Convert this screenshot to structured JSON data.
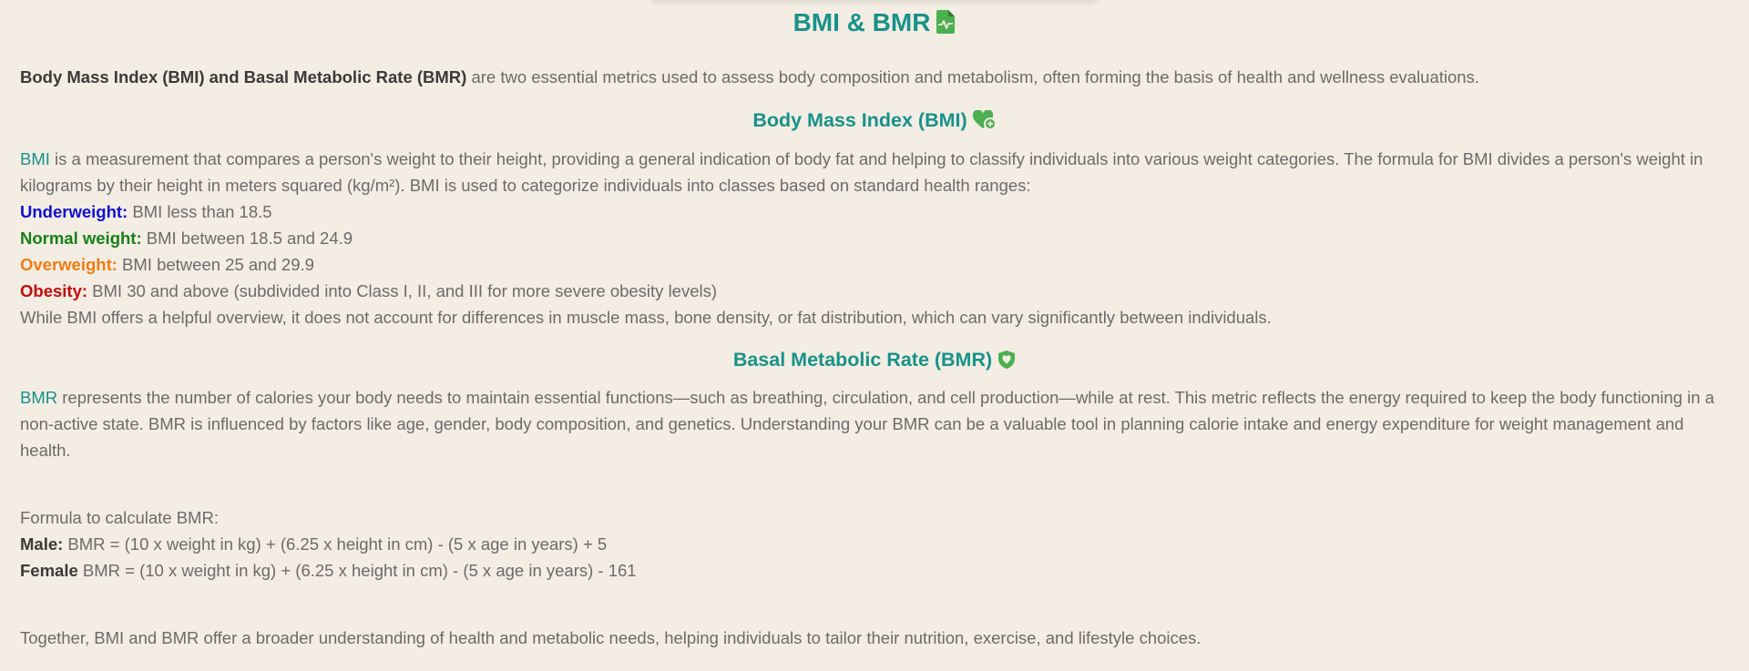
{
  "title": "BMI & BMR",
  "intro": {
    "bold": "Body Mass Index (BMI) and Basal Metabolic Rate (BMR)",
    "rest": " are two essential metrics used to assess body composition and metabolism, often forming the basis of health and wellness evaluations."
  },
  "bmi": {
    "heading": "Body Mass Index (BMI)",
    "term": "BMI",
    "description": " is a measurement that compares a person's weight to their height, providing a general indication of body fat and helping to classify individuals into various weight categories. The formula for BMI divides a person's weight in kilograms by their height in meters squared (kg/m²). BMI is used to categorize individuals into classes based on standard health ranges:",
    "categories": [
      {
        "label": "Underweight:",
        "text": " BMI less than 18.5",
        "color": "#1010d0"
      },
      {
        "label": "Normal weight:",
        "text": " BMI between 18.5 and 24.9",
        "color": "#178017"
      },
      {
        "label": "Overweight:",
        "text": " BMI between 25 and 29.9",
        "color": "#f07d12"
      },
      {
        "label": "Obesity:",
        "text": " BMI 30 and above (subdivided into Class I, II, and III for more severe obesity levels)",
        "color": "#c40c0c"
      }
    ],
    "note": "While BMI offers a helpful overview, it does not account for differences in muscle mass, bone density, or fat distribution, which can vary significantly between individuals."
  },
  "bmr": {
    "heading": "Basal Metabolic Rate (BMR)",
    "term": "BMR",
    "description": " represents the number of calories your body needs to maintain essential functions—such as breathing, circulation, and cell production—while at rest. This metric reflects the energy required to keep the body functioning in a non-active state. BMR is influenced by factors like age, gender, body composition, and genetics. Understanding your BMR can be a valuable tool in planning calorie intake and energy expenditure for weight management and health.",
    "formula_intro": "Formula to calculate BMR:",
    "male_label": "Male:",
    "male_formula": " BMR = (10 x weight in kg) + (6.25 x height in cm) - (5 x age in years) + 5",
    "female_label": "Female",
    "female_formula": " BMR = (10 x weight in kg) + (6.25 x height in cm) - (5 x age in years) - 161"
  },
  "conclusion": "Together, BMI and BMR offer a broader understanding of health and metabolic needs, helping individuals to tailor their nutrition, exercise, and lifestyle choices.",
  "icons": {
    "title_icon": "file-medical-icon",
    "bmi_icon": "heart-plus-icon",
    "bmr_icon": "shield-heart-icon"
  },
  "colors": {
    "accent": "#17928a",
    "icon_green": "#4caf50",
    "background": "#f3ede3"
  }
}
